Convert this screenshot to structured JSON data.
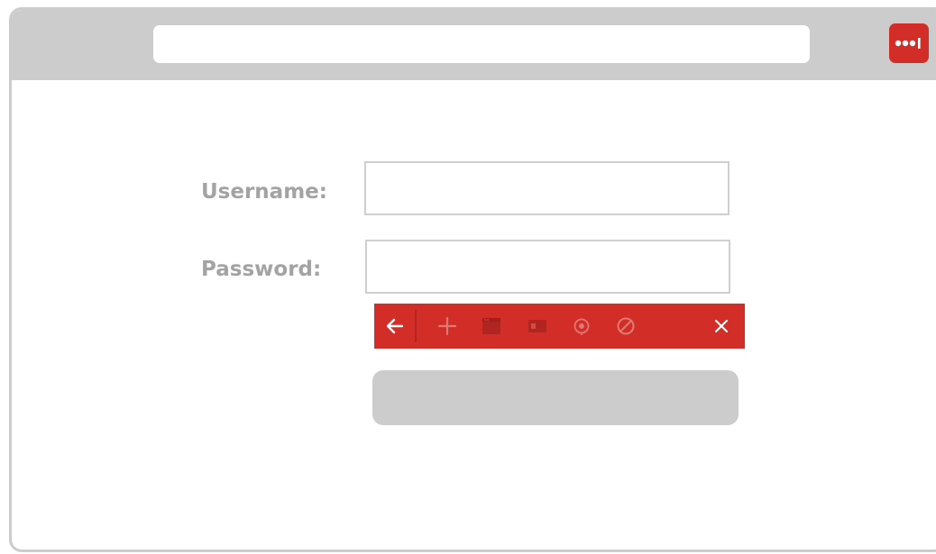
{
  "browser": {
    "address_bar": {
      "value": ""
    },
    "extension": {
      "icon": "password-manager-dots-icon",
      "color": "#d32d27"
    }
  },
  "form": {
    "username_label": "Username:",
    "password_label": "Password:",
    "username_value": "",
    "password_value": "",
    "submit_label": ""
  },
  "popup_toolbar": {
    "color": "#d32d27",
    "icons": [
      {
        "name": "back-arrow-icon",
        "state": "active"
      },
      {
        "name": "add-icon",
        "state": "dim"
      },
      {
        "name": "site-icon",
        "state": "dim"
      },
      {
        "name": "card-icon",
        "state": "dim"
      },
      {
        "name": "generate-password-icon",
        "state": "dim"
      },
      {
        "name": "never-icon",
        "state": "dim"
      },
      {
        "name": "close-icon",
        "state": "active"
      }
    ]
  },
  "colors": {
    "chrome_gray": "#cccccc",
    "label_gray": "#a3a3a3",
    "accent_red": "#d32d27"
  }
}
